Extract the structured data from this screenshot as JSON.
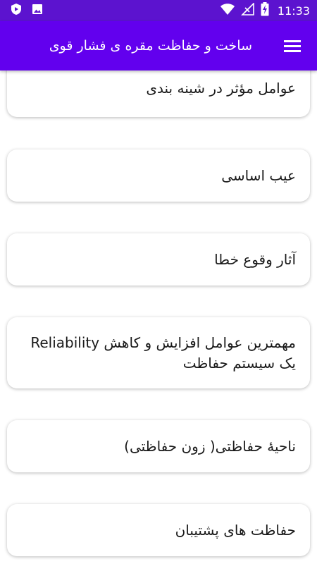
{
  "status_bar": {
    "time": "11:33",
    "icons": [
      "play-protect-icon",
      "image-icon",
      "wifi-icon",
      "no-signal-icon",
      "battery-charging-icon"
    ],
    "background": "#5c13cf"
  },
  "app_bar": {
    "title": "ساخت و حفاظت مقره ی فشار قوی",
    "menu_icon": "hamburger-menu-icon",
    "background": "#6200ee"
  },
  "list": {
    "items": [
      {
        "label": "عوامل مؤثر در شینه بندی"
      },
      {
        "label": "عیب اساسی"
      },
      {
        "label": "آثار وقوع خطا"
      },
      {
        "label": "مهمترین عوامل افزایش و کاهش Reliability یک سیستم حفاظت"
      },
      {
        "label": "ناحیۀ حفاظتی( زون حفاظتی)"
      },
      {
        "label": "حفاظت های پشتیبان"
      }
    ]
  }
}
